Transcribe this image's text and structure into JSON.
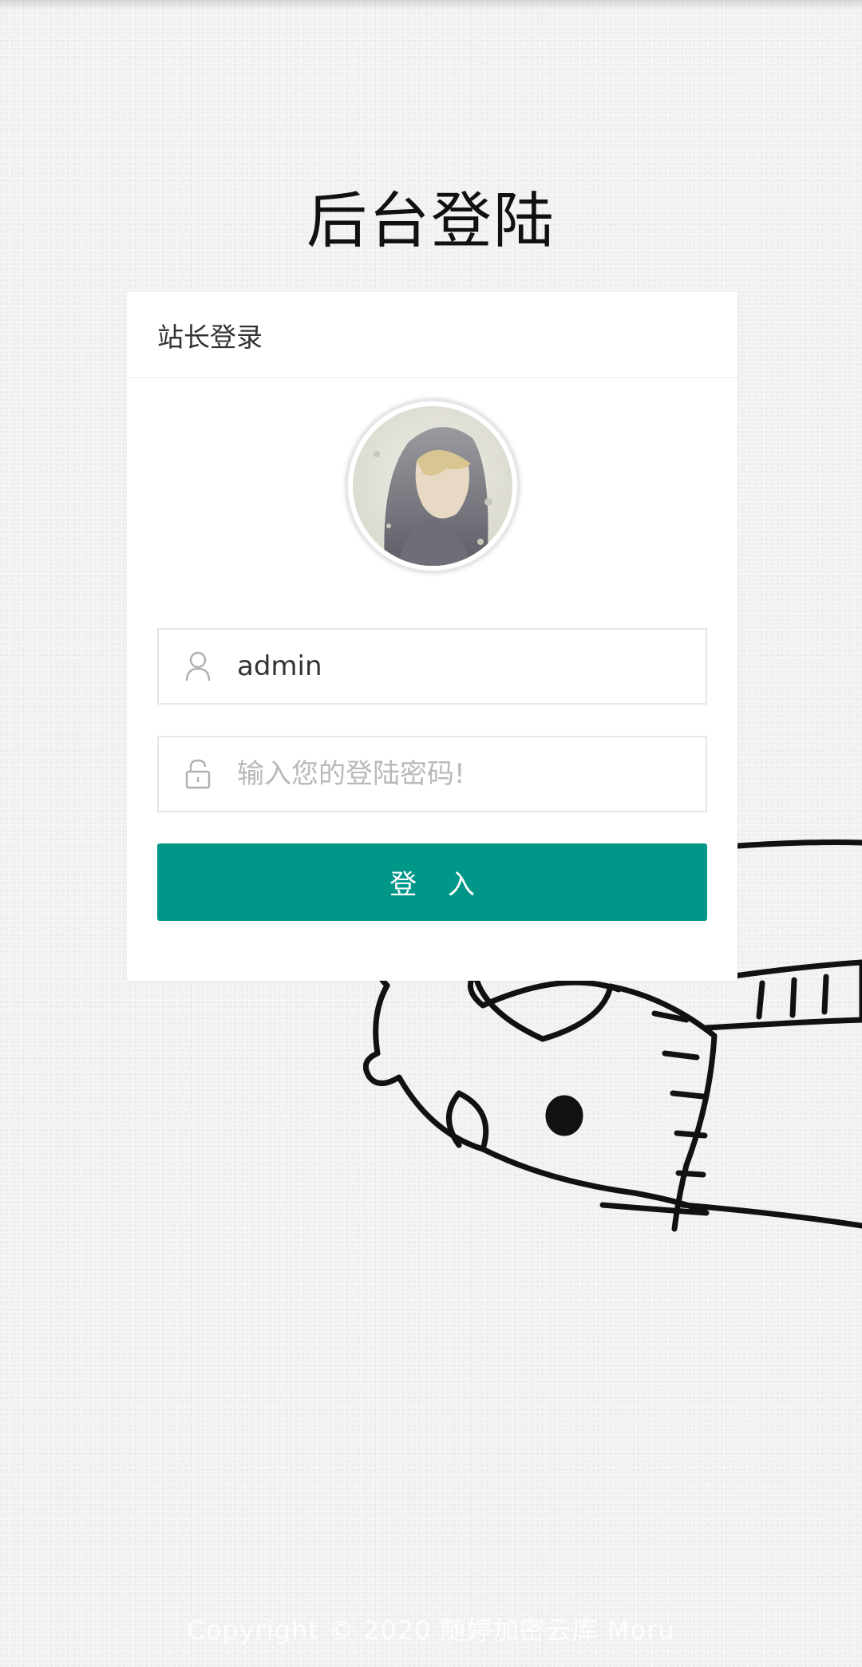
{
  "page": {
    "title": "后台登陆",
    "footer": "Copyright © 2020  随婷加密云库 Moru"
  },
  "card": {
    "header": "站长登录",
    "username": {
      "value": "admin",
      "placeholder": "",
      "icon": "user-icon"
    },
    "password": {
      "value": "",
      "placeholder": "输入您的登陆密码!",
      "icon": "lock-icon"
    },
    "login_button": "登 入"
  },
  "colors": {
    "accent": "#009688",
    "background": "#f1f1f0"
  }
}
